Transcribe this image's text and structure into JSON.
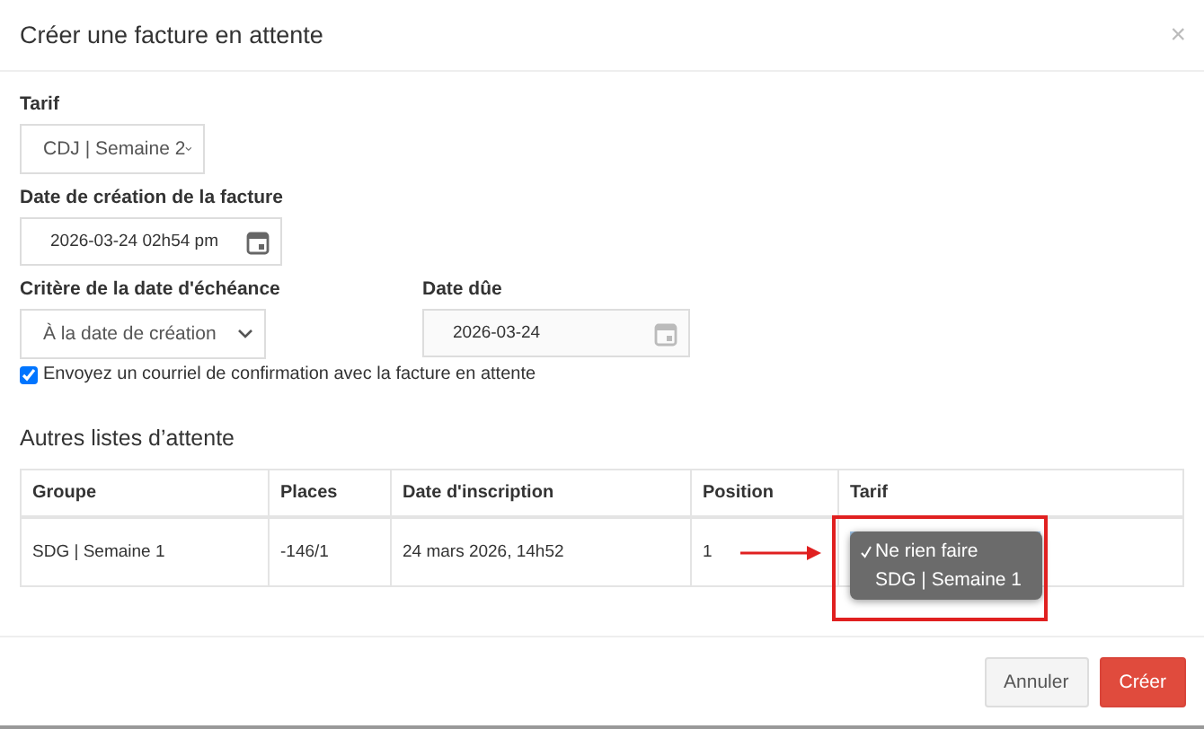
{
  "dialog": {
    "title": "Créer une facture en attente",
    "close": "×"
  },
  "form": {
    "tarif": {
      "label": "Tarif",
      "value": "CDJ | Semaine 2"
    },
    "creation_date": {
      "label": "Date de création de la facture",
      "value": "2026-03-24 02h54 pm"
    },
    "due_criterion": {
      "label": "Critère de la date d'échéance",
      "value": "À la date de création"
    },
    "due_date": {
      "label": "Date dûe",
      "value": "2026-03-24",
      "disabled": true
    },
    "confirmation": {
      "label": "Envoyez un courriel de confirmation avec la facture en attente",
      "checked": true
    }
  },
  "other_lists": {
    "title": "Autres listes d’attente",
    "columns": [
      "Groupe",
      "Places",
      "Date d'inscription",
      "Position",
      "Tarif"
    ],
    "rows": [
      {
        "cells": [
          "SDG | Semaine 1",
          "-146/1",
          "24 mars 2026, 14h52",
          "1"
        ],
        "tarif_menu": [
          {
            "label": "Ne rien faire",
            "selected": true
          },
          {
            "label": "SDG | Semaine 1",
            "selected": false
          }
        ]
      }
    ]
  },
  "buttons": [
    {
      "label": "Annuler",
      "kind": "secondary"
    },
    {
      "label": "Créer",
      "kind": "primary"
    }
  ]
}
